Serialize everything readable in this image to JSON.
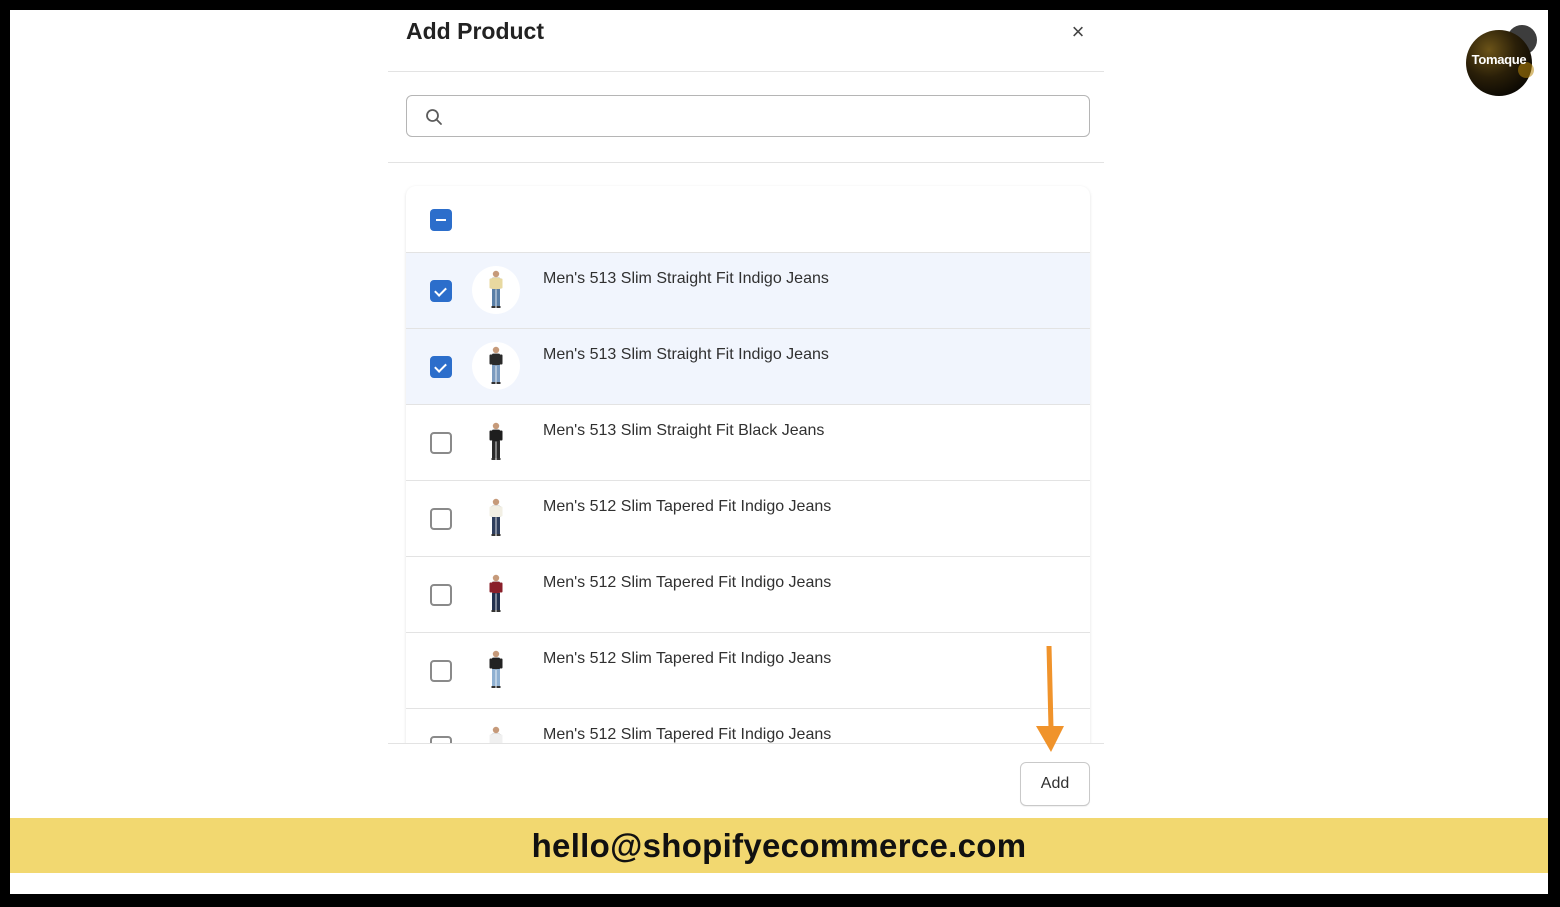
{
  "modal": {
    "title": "Add Product",
    "close_symbol": "×",
    "search": {
      "value": "",
      "placeholder": ""
    },
    "add_button_label": "Add"
  },
  "products": [
    {
      "title": "Men's 513 Slim Straight Fit Indigo Jeans",
      "checked": true,
      "shirt_color": "#e8d9a0",
      "pants_color": "#5a7fa6"
    },
    {
      "title": "Men's 513 Slim Straight Fit Indigo Jeans",
      "checked": true,
      "shirt_color": "#2a2a2a",
      "pants_color": "#7b9bbf"
    },
    {
      "title": "Men's 513 Slim Straight Fit Black Jeans",
      "checked": false,
      "shirt_color": "#1e1e1e",
      "pants_color": "#2b2b2b"
    },
    {
      "title": "Men's 512 Slim Tapered Fit Indigo Jeans",
      "checked": false,
      "shirt_color": "#f2efe4",
      "pants_color": "#2e3e5c"
    },
    {
      "title": "Men's 512 Slim Tapered Fit Indigo Jeans",
      "checked": false,
      "shirt_color": "#8a1f2a",
      "pants_color": "#23314f"
    },
    {
      "title": "Men's 512 Slim Tapered Fit Indigo Jeans",
      "checked": false,
      "shirt_color": "#222222",
      "pants_color": "#8fb0d1"
    },
    {
      "title": "Men's 512 Slim Tapered Fit Indigo Jeans",
      "checked": false,
      "shirt_color": "#f0f0f0",
      "pants_color": "#9cb7d4"
    }
  ],
  "logo": {
    "text": "Tomaque"
  },
  "banner": {
    "text": "hello@shopifyecommerce.com"
  },
  "colors": {
    "accent": "#2c6ecb",
    "selected_row": "#f1f5fd",
    "arrow": "#f0932b",
    "banner": "#f2d870"
  }
}
